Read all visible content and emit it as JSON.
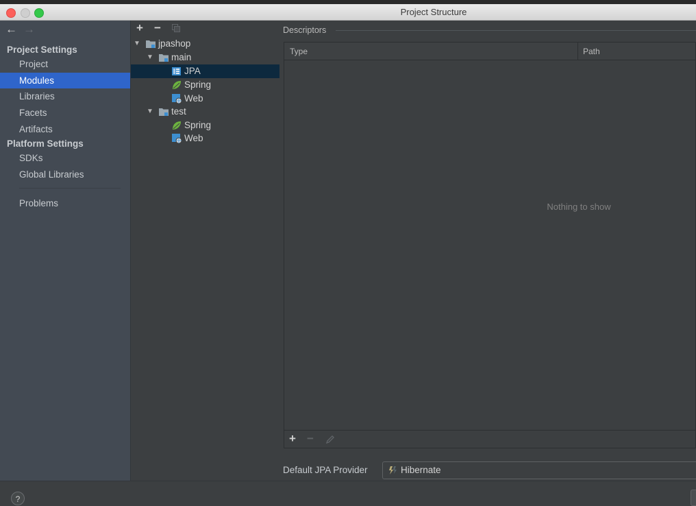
{
  "window": {
    "title": "Project Structure"
  },
  "nav": {
    "back_icon": "←",
    "forward_icon": "→"
  },
  "sidebar": {
    "project_settings_header": "Project Settings",
    "items_project": [
      {
        "label": "Project",
        "selected": false
      },
      {
        "label": "Modules",
        "selected": true
      },
      {
        "label": "Libraries",
        "selected": false
      },
      {
        "label": "Facets",
        "selected": false
      },
      {
        "label": "Artifacts",
        "selected": false
      }
    ],
    "platform_settings_header": "Platform Settings",
    "items_platform": [
      {
        "label": "SDKs"
      },
      {
        "label": "Global Libraries"
      }
    ],
    "problems_label": "Problems"
  },
  "tree_toolbar": {
    "add": "+",
    "remove": "−",
    "copy_icon": "copy-icon"
  },
  "tree": {
    "root": {
      "label": "jpashop",
      "icon": "module-folder-icon",
      "expanded": true
    },
    "main": {
      "label": "main",
      "icon": "module-folder-icon",
      "expanded": true,
      "children": [
        {
          "label": "JPA",
          "icon": "jpa-icon",
          "selected": true
        },
        {
          "label": "Spring",
          "icon": "spring-leaf-icon"
        },
        {
          "label": "Web",
          "icon": "web-icon"
        }
      ]
    },
    "test": {
      "label": "test",
      "icon": "module-folder-icon",
      "expanded": true,
      "children": [
        {
          "label": "Spring",
          "icon": "spring-leaf-icon"
        },
        {
          "label": "Web",
          "icon": "web-icon"
        }
      ]
    }
  },
  "descriptors": {
    "title": "Descriptors",
    "columns": [
      "Type",
      "Path"
    ],
    "empty_text": "Nothing to show",
    "toolbar": {
      "add": "+",
      "remove": "−",
      "edit_icon": "pencil-icon"
    }
  },
  "provider": {
    "label": "Default JPA Provider",
    "value": "Hibernate",
    "icon": "hibernate-icon"
  },
  "bottom": {
    "help": "?"
  },
  "colors": {
    "selection": "#2f65ca",
    "tree_selection": "#0d293e",
    "sidebar_bg": "#434a53",
    "panel_bg": "#3c3f41",
    "spring_green": "#6db33f",
    "module_blue": "#3d8fd1"
  }
}
